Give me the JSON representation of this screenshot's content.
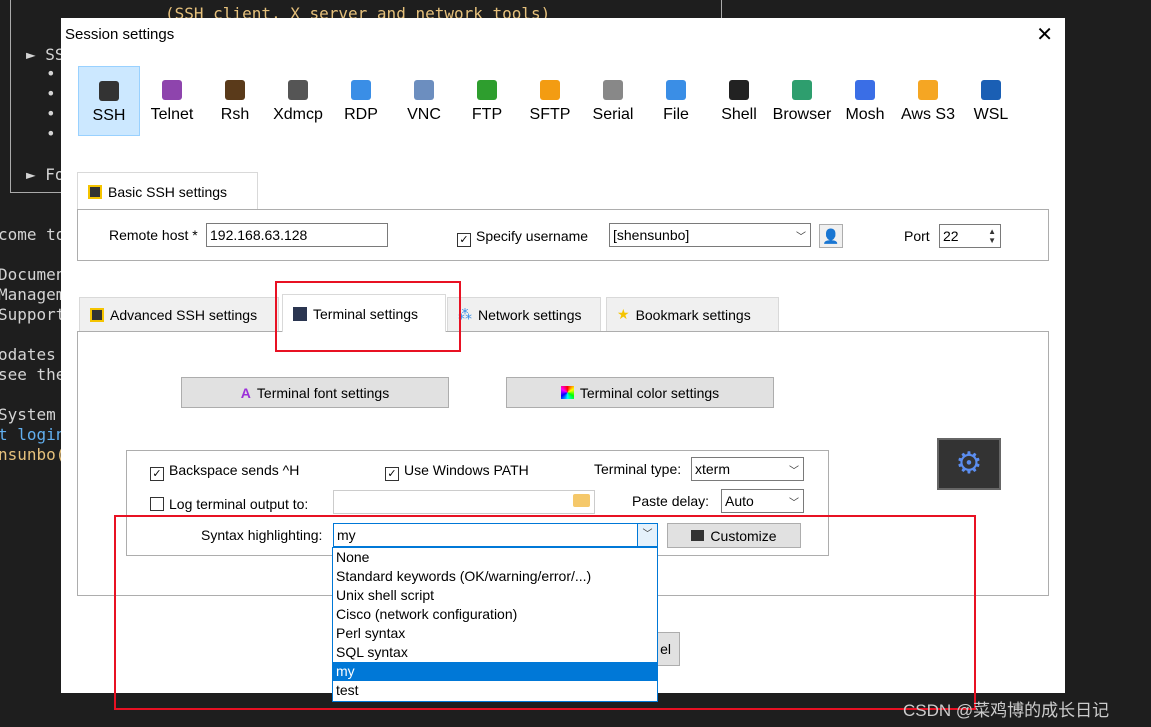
{
  "terminal": {
    "header": "(SSH client, X server and network tools)",
    "lines": [
      "► SS",
      "•",
      "•",
      "•",
      "•",
      "► Fo",
      "come to",
      "Documen",
      "Managem",
      "Support",
      "odates",
      "see the",
      "System",
      "t login",
      "nsunbo("
    ]
  },
  "dialog": {
    "title": "Session settings",
    "close": "✕",
    "protocols": [
      {
        "label": "SSH",
        "color": "#333"
      },
      {
        "label": "Telnet",
        "color": "#8e44ad"
      },
      {
        "label": "Rsh",
        "color": "#5a3a1a"
      },
      {
        "label": "Xdmcp",
        "color": "#555"
      },
      {
        "label": "RDP",
        "color": "#3a8ee6"
      },
      {
        "label": "VNC",
        "color": "#6c8ebf"
      },
      {
        "label": "FTP",
        "color": "#2e9e2e"
      },
      {
        "label": "SFTP",
        "color": "#f39c12"
      },
      {
        "label": "Serial",
        "color": "#888"
      },
      {
        "label": "File",
        "color": "#3a8ee6"
      },
      {
        "label": "Shell",
        "color": "#222"
      },
      {
        "label": "Browser",
        "color": "#2e9e6e"
      },
      {
        "label": "Mosh",
        "color": "#3a6ee6"
      },
      {
        "label": "Aws S3",
        "color": "#f5a623"
      },
      {
        "label": "WSL",
        "color": "#1a5fb4"
      }
    ],
    "basic_tab": "Basic SSH settings",
    "remote_host_label": "Remote host *",
    "remote_host": "192.168.63.128",
    "specify_username_label": "Specify username",
    "username": "[shensunbo]",
    "port_label": "Port",
    "port": "22",
    "tabs": [
      "Advanced SSH settings",
      "Terminal settings",
      "Network settings",
      "Bookmark settings"
    ],
    "font_btn": "Terminal font settings",
    "color_btn": "Terminal color settings",
    "backspace": "Backspace sends ^H",
    "windows_path": "Use Windows PATH",
    "terminal_type_label": "Terminal type:",
    "terminal_type": "xterm",
    "log_label": "Log terminal output to:",
    "log_value": "",
    "paste_delay_label": "Paste delay:",
    "paste_delay": "Auto",
    "syntax_label": "Syntax highlighting:",
    "syntax_value": "my",
    "customize": "Customize",
    "syntax_options": [
      "None",
      "Standard keywords (OK/warning/error/...)",
      "Unix shell script",
      "Cisco (network configuration)",
      "Perl syntax",
      "SQL syntax",
      "my",
      "test"
    ],
    "selected_option": "my",
    "cancel_partial": "el"
  },
  "watermark": "CSDN @菜鸡博的成长日记",
  "colors": {
    "accent": "#0078d7",
    "highlight_box": "#e81123"
  }
}
